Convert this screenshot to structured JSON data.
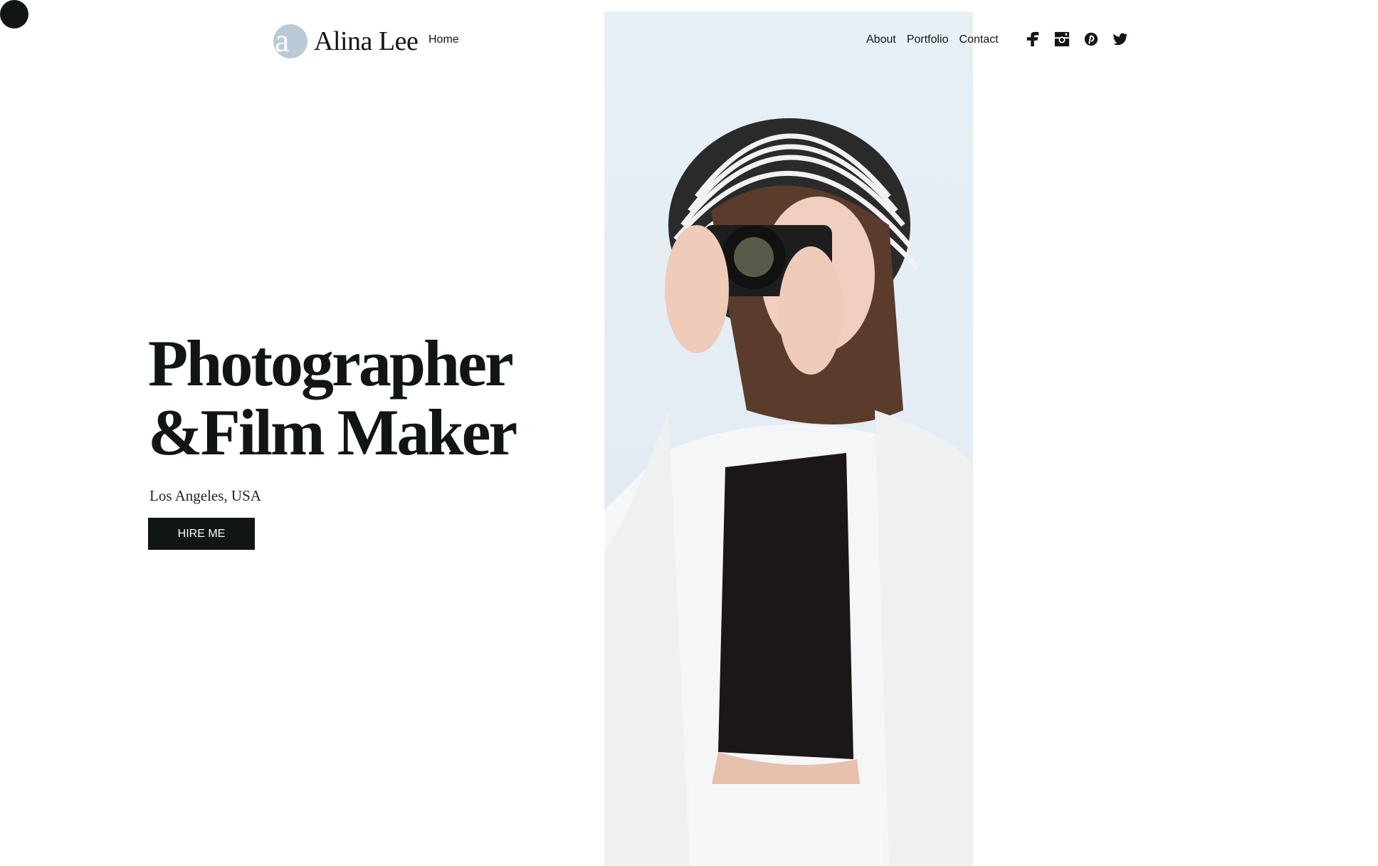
{
  "logo": {
    "mark": "a",
    "name": "Alina Lee",
    "mark_color": "#b9cad7"
  },
  "nav": {
    "home": "Home",
    "items": [
      "About",
      "Portfolio",
      "Contact"
    ]
  },
  "social": [
    "facebook-icon",
    "instagram-icon",
    "pinterest-icon",
    "twitter-icon"
  ],
  "hero": {
    "title_line1": "Photographer",
    "title_line2": "&Film Maker",
    "location": "Los Angeles, USA",
    "cta": "HIRE ME"
  },
  "colors": {
    "text": "#111516",
    "photo_bg": "#e8f0f6"
  }
}
